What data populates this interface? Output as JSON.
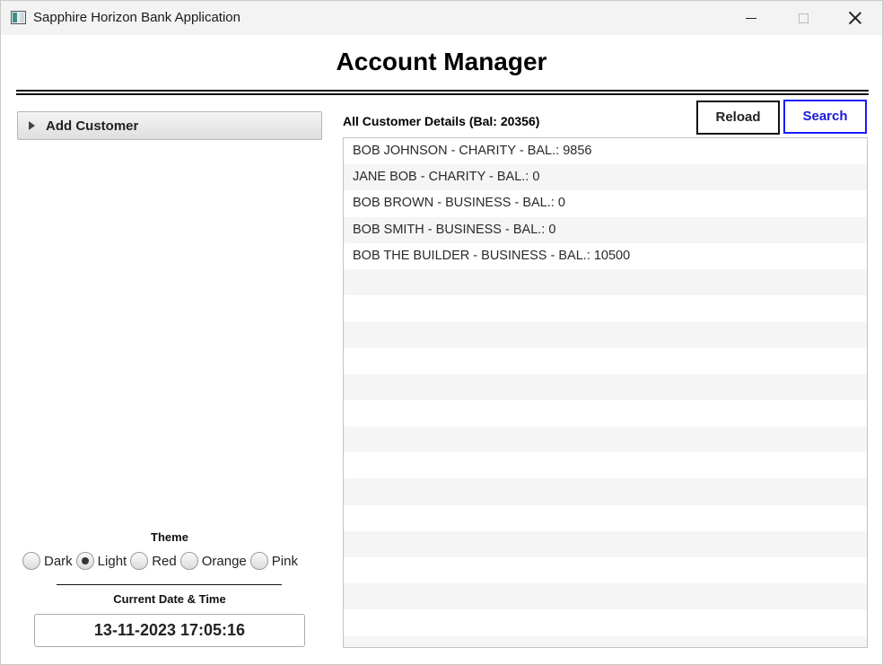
{
  "window": {
    "title": "Sapphire Horizon Bank Application",
    "icon": "app-icon",
    "controls": [
      "minimize-icon",
      "maximize-icon",
      "close-icon"
    ]
  },
  "header": {
    "title": "Account Manager"
  },
  "left_pane": {
    "accordion_label": "Add Customer",
    "theme_label": "Theme",
    "themes": [
      {
        "label": "Dark",
        "checked": false
      },
      {
        "label": "Light",
        "checked": true
      },
      {
        "label": "Red",
        "checked": false
      },
      {
        "label": "Orange",
        "checked": false
      },
      {
        "label": "Pink",
        "checked": false
      }
    ],
    "datetime_label": "Current Date & Time",
    "datetime_value": "13-11-2023 17:05:16"
  },
  "right_pane": {
    "list_title": "All Customer Details (Bal: 20356)",
    "reload_label": "Reload",
    "search_label": "Search",
    "customers": [
      "BOB JOHNSON - CHARITY - BAL.: 9856",
      "JANE BOB - CHARITY - BAL.: 0",
      "BOB BROWN - BUSINESS - BAL.: 0",
      "BOB SMITH - BUSINESS - BAL.: 0",
      "BOB THE BUILDER - BUSINESS - BAL.: 10500"
    ]
  },
  "colors": {
    "search_accent": "#1a1aff",
    "titlebar_bg": "#f3f3f3",
    "row_stripe": "#f5f5f5"
  }
}
